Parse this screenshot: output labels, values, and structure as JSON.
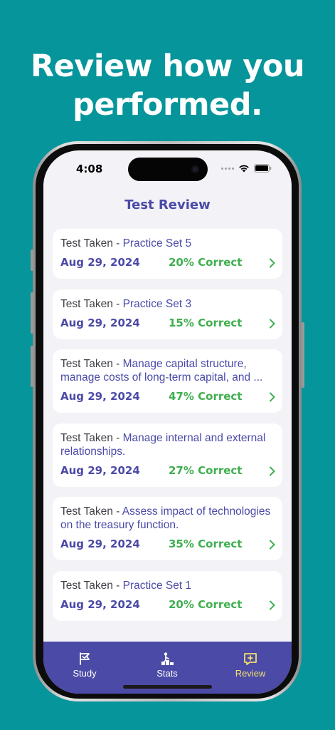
{
  "headline": {
    "line1": "Review how you",
    "line2": "performed."
  },
  "status_bar": {
    "time": "4:08"
  },
  "header": {
    "title": "Test Review"
  },
  "colors": {
    "background": "#05959a",
    "accent": "#4b4aa6",
    "correct": "#3fae4f",
    "active_tab": "#f2df6b"
  },
  "tests": [
    {
      "prefix": "Test Taken - ",
      "name": "Practice Set 5",
      "date": "Aug 29, 2024",
      "score": "20% Correct"
    },
    {
      "prefix": "Test Taken - ",
      "name": "Practice Set 3",
      "date": "Aug 29, 2024",
      "score": "15% Correct"
    },
    {
      "prefix": "Test Taken - ",
      "name": "Manage capital structure, manage costs of long-term capital, and ...",
      "date": "Aug 29, 2024",
      "score": "47% Correct"
    },
    {
      "prefix": "Test Taken - ",
      "name": "Manage internal and external relationships.",
      "date": "Aug 29, 2024",
      "score": "27% Correct"
    },
    {
      "prefix": "Test Taken - ",
      "name": "Assess impact of technologies on the treasury function.",
      "date": "Aug 29, 2024",
      "score": "35% Correct"
    },
    {
      "prefix": "Test Taken - ",
      "name": "Practice Set 1",
      "date": "Aug 29, 2024",
      "score": "20% Correct"
    }
  ],
  "tabs": [
    {
      "label": "Study",
      "icon": "flag-book-icon"
    },
    {
      "label": "Stats",
      "icon": "podium-person-icon"
    },
    {
      "label": "Review",
      "icon": "review-plus-icon",
      "active": true
    }
  ]
}
